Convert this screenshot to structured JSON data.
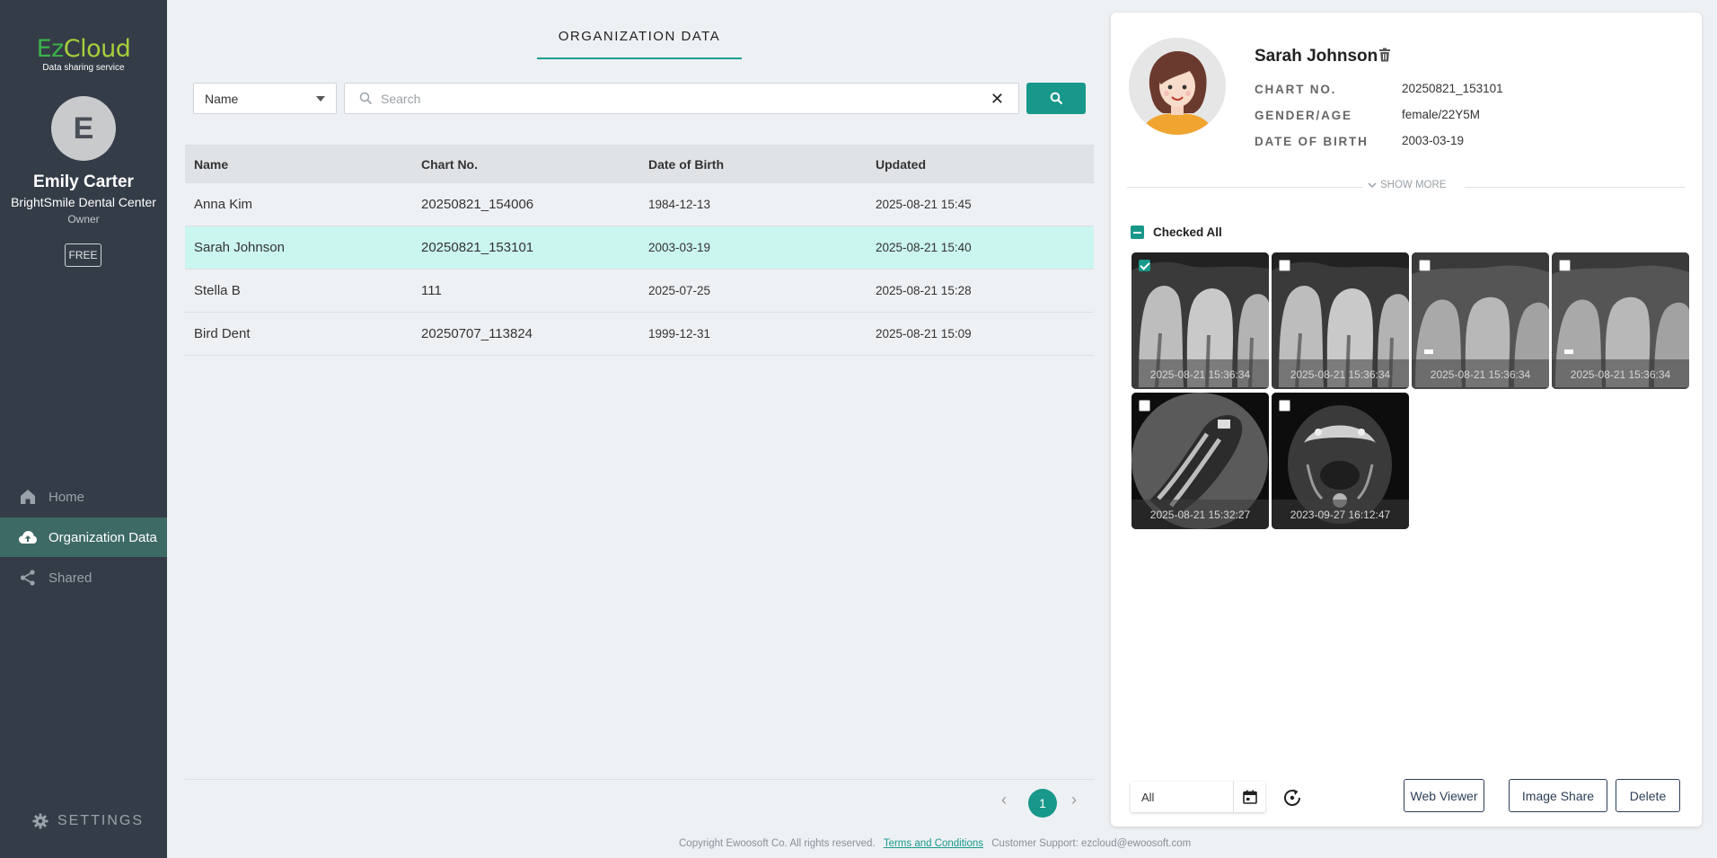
{
  "sidebar": {
    "logo_ez": "Ez",
    "logo_cloud": "Cloud",
    "logo_sub": "Data sharing service",
    "avatar_letter": "E",
    "user_name": "Emily Carter",
    "org_name": "BrightSmile Dental Center",
    "role": "Owner",
    "plan": "FREE",
    "nav": [
      {
        "label": "Home",
        "icon": "home-icon"
      },
      {
        "label": "Organization Data",
        "icon": "cloud-upload-icon"
      },
      {
        "label": "Shared",
        "icon": "share-icon"
      }
    ],
    "settings_label": "SETTINGS",
    "active_color": "#3e6a66"
  },
  "main": {
    "tab_title": "ORGANIZATION DATA",
    "filter_select": "Name",
    "search_placeholder": "Search",
    "search_value": "",
    "columns": [
      "Name",
      "Chart No.",
      "Date of Birth",
      "Updated"
    ],
    "rows": [
      {
        "name": "Anna Kim",
        "chart": "20250821_154006",
        "dob": "1984-12-13",
        "updated": "2025-08-21 15:45",
        "selected": false
      },
      {
        "name": "Sarah Johnson",
        "chart": "20250821_153101",
        "dob": "2003-03-19",
        "updated": "2025-08-21 15:40",
        "selected": true
      },
      {
        "name": "Stella B",
        "chart": "111",
        "dob": "2025-07-25",
        "updated": "2025-08-21 15:28",
        "selected": false
      },
      {
        "name": "Bird Dent",
        "chart": "20250707_113824",
        "dob": "1999-12-31",
        "updated": "2025-08-21 15:09",
        "selected": false
      }
    ],
    "pagination": {
      "prev": "‹",
      "current": "1",
      "next": "›"
    },
    "accent": "#17988a"
  },
  "footer": {
    "copyright": "Copyright Ewoosoft Co. All rights reserved.",
    "terms": "Terms and Conditions",
    "support": "Customer Support: ezcloud@ewoosoft.com"
  },
  "patient": {
    "name": "Sarah Johnson",
    "info": [
      {
        "label": "CHART NO.",
        "value": "20250821_153101"
      },
      {
        "label": "GENDER/AGE",
        "value": "female/22Y5M"
      },
      {
        "label": "DATE OF BIRTH",
        "value": "2003-03-19"
      }
    ],
    "show_more": "SHOW MORE",
    "checked_all": "Checked All",
    "images": [
      {
        "date": "2025-08-21 15:36:34",
        "checked": true,
        "kind": "xray"
      },
      {
        "date": "2025-08-21 15:36:34",
        "checked": false,
        "kind": "xray"
      },
      {
        "date": "2025-08-21 15:36:34",
        "checked": false,
        "kind": "xray"
      },
      {
        "date": "2025-08-21 15:36:34",
        "checked": false,
        "kind": "xray"
      },
      {
        "date": "2025-08-21 15:32:27",
        "checked": false,
        "kind": "ct-circle"
      },
      {
        "date": "2023-09-27 16:12:47",
        "checked": false,
        "kind": "ct-axial"
      }
    ],
    "date_filter": "All",
    "buttons": {
      "web_viewer": "Web Viewer",
      "image_share": "Image Share",
      "delete": "Delete"
    }
  }
}
